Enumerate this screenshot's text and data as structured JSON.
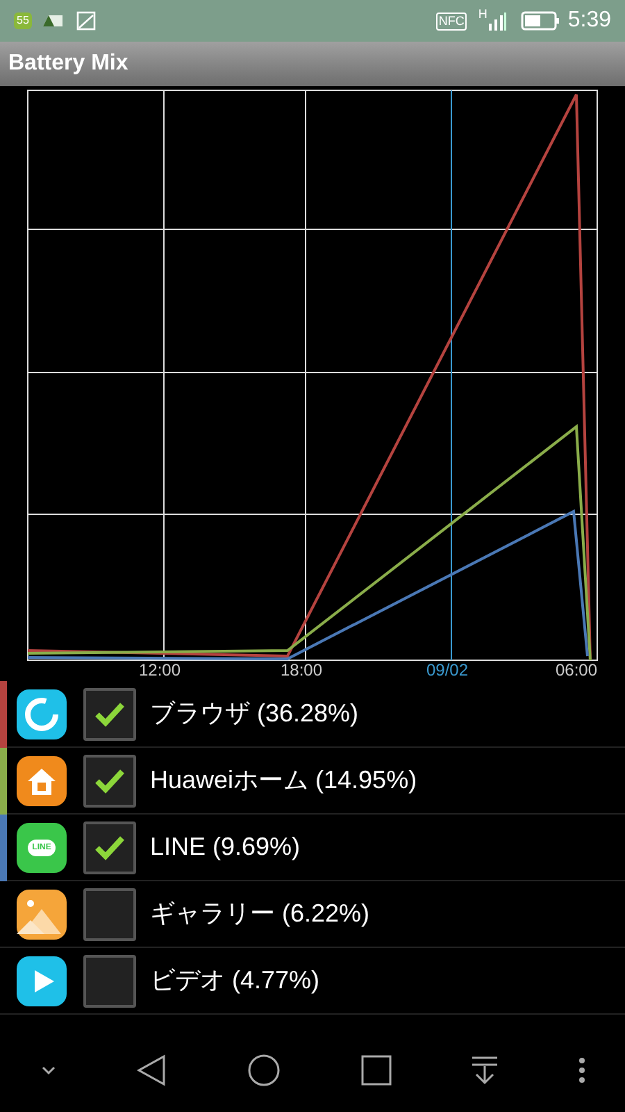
{
  "status_bar": {
    "badge": "55",
    "nfc": "NFC",
    "network": "H",
    "time": "5:39"
  },
  "title": "Battery Mix",
  "chart": {
    "xticks": [
      {
        "label": "12:00",
        "highlight": false
      },
      {
        "label": "18:00",
        "highlight": false
      },
      {
        "label": "09/02",
        "highlight": true
      },
      {
        "label": "06:00",
        "highlight": false
      }
    ]
  },
  "apps": [
    {
      "kind": "browser",
      "name": "ブラウザ (36.28%)",
      "checked": true,
      "color": "#b5433f"
    },
    {
      "kind": "home",
      "name": "Huaweiホーム (14.95%)",
      "checked": true,
      "color": "#8aad4a"
    },
    {
      "kind": "line",
      "icon_text": "LINE",
      "name": "LINE (9.69%)",
      "checked": true,
      "color": "#4a78b5"
    },
    {
      "kind": "gallery",
      "name": "ギャラリー (6.22%)",
      "checked": false
    },
    {
      "kind": "video",
      "name": "ビデオ (4.77%)",
      "checked": false
    }
  ]
}
